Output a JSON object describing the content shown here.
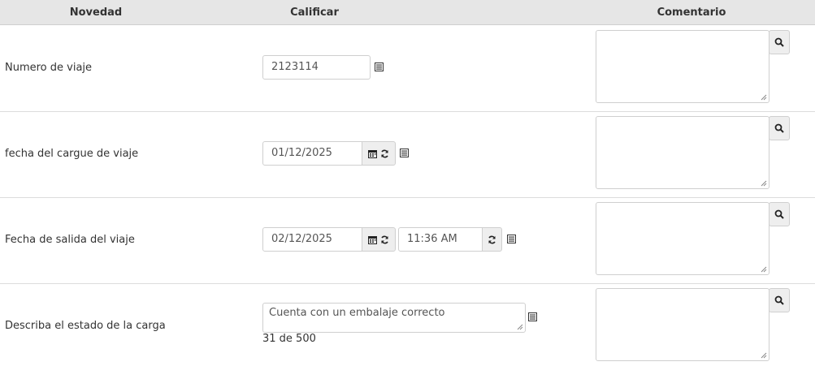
{
  "table": {
    "headers": {
      "novedad": "Novedad",
      "calificar": "Calificar",
      "comentario": "Comentario"
    },
    "rows": [
      {
        "label": "Numero de viaje",
        "value": "2123114"
      },
      {
        "label": "fecha del cargue de viaje",
        "date": "01/12/2025"
      },
      {
        "label": "Fecha de salida del viaje",
        "date": "02/12/2025",
        "time": "11:36 AM"
      },
      {
        "label": "Describa el estado de la carga",
        "text": "Cuenta con un embalaje correcto",
        "counter": "31 de 500"
      }
    ]
  },
  "icons": {
    "list": "list-icon",
    "calendar": "calendar-icon",
    "refresh": "refresh-icon",
    "search": "search-icon"
  }
}
